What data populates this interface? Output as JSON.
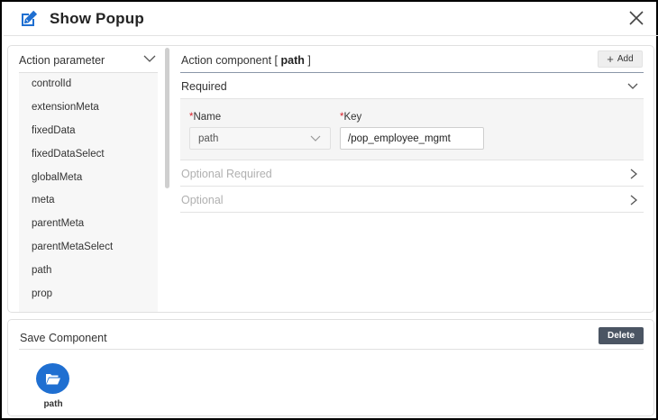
{
  "colors": {
    "accent_blue": "#1f6fd1",
    "required_star": "#d9232d",
    "delete_button": "#4b5563",
    "muted_text": "#b0b0b0"
  },
  "header": {
    "icon": "edit-icon",
    "title": "Show Popup",
    "close_icon": "close-icon"
  },
  "action_parameter": {
    "label": "Action parameter",
    "items": [
      "controlId",
      "extensionMeta",
      "fixedData",
      "fixedDataSelect",
      "globalMeta",
      "meta",
      "parentMeta",
      "parentMetaSelect",
      "path",
      "prop"
    ]
  },
  "action_component": {
    "title_prefix": "Action component [",
    "title_value": "path",
    "title_suffix": "]",
    "add_label": "Add",
    "sections": {
      "required": "Required",
      "optional_required": "Optional Required",
      "optional": "Optional"
    },
    "name_label": "Name",
    "key_label": "Key",
    "required_mark": "*",
    "name_value": "path",
    "key_value": "/pop_employee_mgmt"
  },
  "save_component": {
    "title": "Save Component",
    "delete_label": "Delete",
    "items": [
      {
        "label": "path",
        "icon": "folder-open-icon"
      }
    ]
  }
}
